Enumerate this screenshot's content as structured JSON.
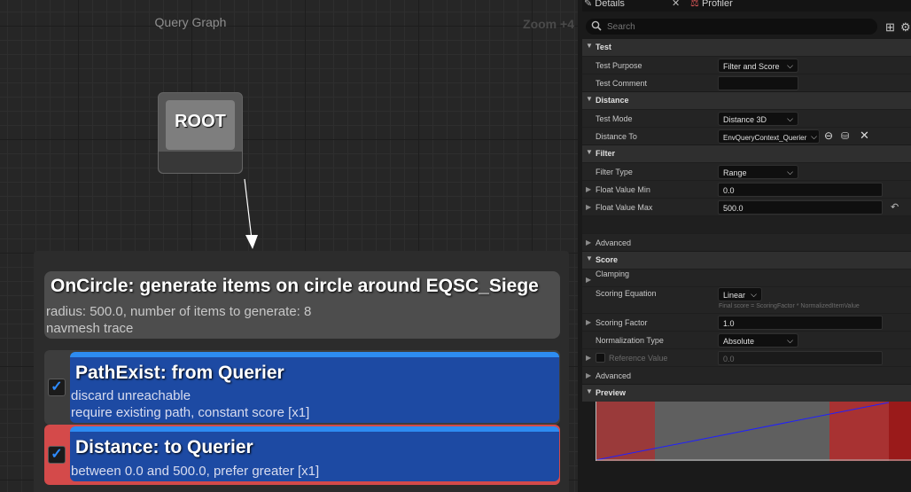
{
  "graph": {
    "title": "Query Graph",
    "zoom": "Zoom +4",
    "root_label": "ROOT",
    "generator": {
      "title": "OnCircle: generate items on circle around EQSC_Siege",
      "line1": "radius: 500.0, number of items to generate: 8",
      "line2": "navmesh trace"
    },
    "tests": [
      {
        "title": "PathExist: from Querier",
        "line1": "discard unreachable",
        "line2": "require existing path, constant score [x1]",
        "checked": true
      },
      {
        "title": "Distance: to Querier",
        "line1": "between 0.0 and 500.0, prefer greater [x1]",
        "checked": true
      }
    ]
  },
  "details": {
    "tab_details": "Details",
    "tab_profiler": "Profiler",
    "search_placeholder": "Search",
    "categories": {
      "test": "Test",
      "distance": "Distance",
      "filter": "Filter",
      "score": "Score",
      "preview": "Preview"
    },
    "props": {
      "test_purpose": {
        "label": "Test Purpose",
        "value": "Filter and Score"
      },
      "test_comment": {
        "label": "Test Comment",
        "value": ""
      },
      "test_mode": {
        "label": "Test Mode",
        "value": "Distance 3D"
      },
      "distance_to": {
        "label": "Distance To",
        "value": "EnvQueryContext_Querier"
      },
      "filter_type": {
        "label": "Filter Type",
        "value": "Range"
      },
      "float_value_min": {
        "label": "Float Value Min",
        "value": "0.0"
      },
      "float_value_max": {
        "label": "Float Value Max",
        "value": "500.0"
      },
      "advanced_1": {
        "label": "Advanced"
      },
      "clamping": {
        "label": "Clamping"
      },
      "scoring_equation": {
        "label": "Scoring Equation",
        "value": "Linear"
      },
      "scoring_hint": "Final score = ScoringFactor * NormalizedItemValue",
      "scoring_factor": {
        "label": "Scoring Factor",
        "value": "1.0"
      },
      "normalization_type": {
        "label": "Normalization Type",
        "value": "Absolute"
      },
      "reference_value": {
        "label": "Reference Value",
        "value": "0.0"
      },
      "advanced_2": {
        "label": "Advanced"
      }
    }
  },
  "colors": {
    "test_body": "#1d4aa3",
    "test_top": "#2d8cf2",
    "selection": "#d44a4a",
    "preview_red": "#9a1a1a",
    "preview_line": "#2020ff"
  }
}
